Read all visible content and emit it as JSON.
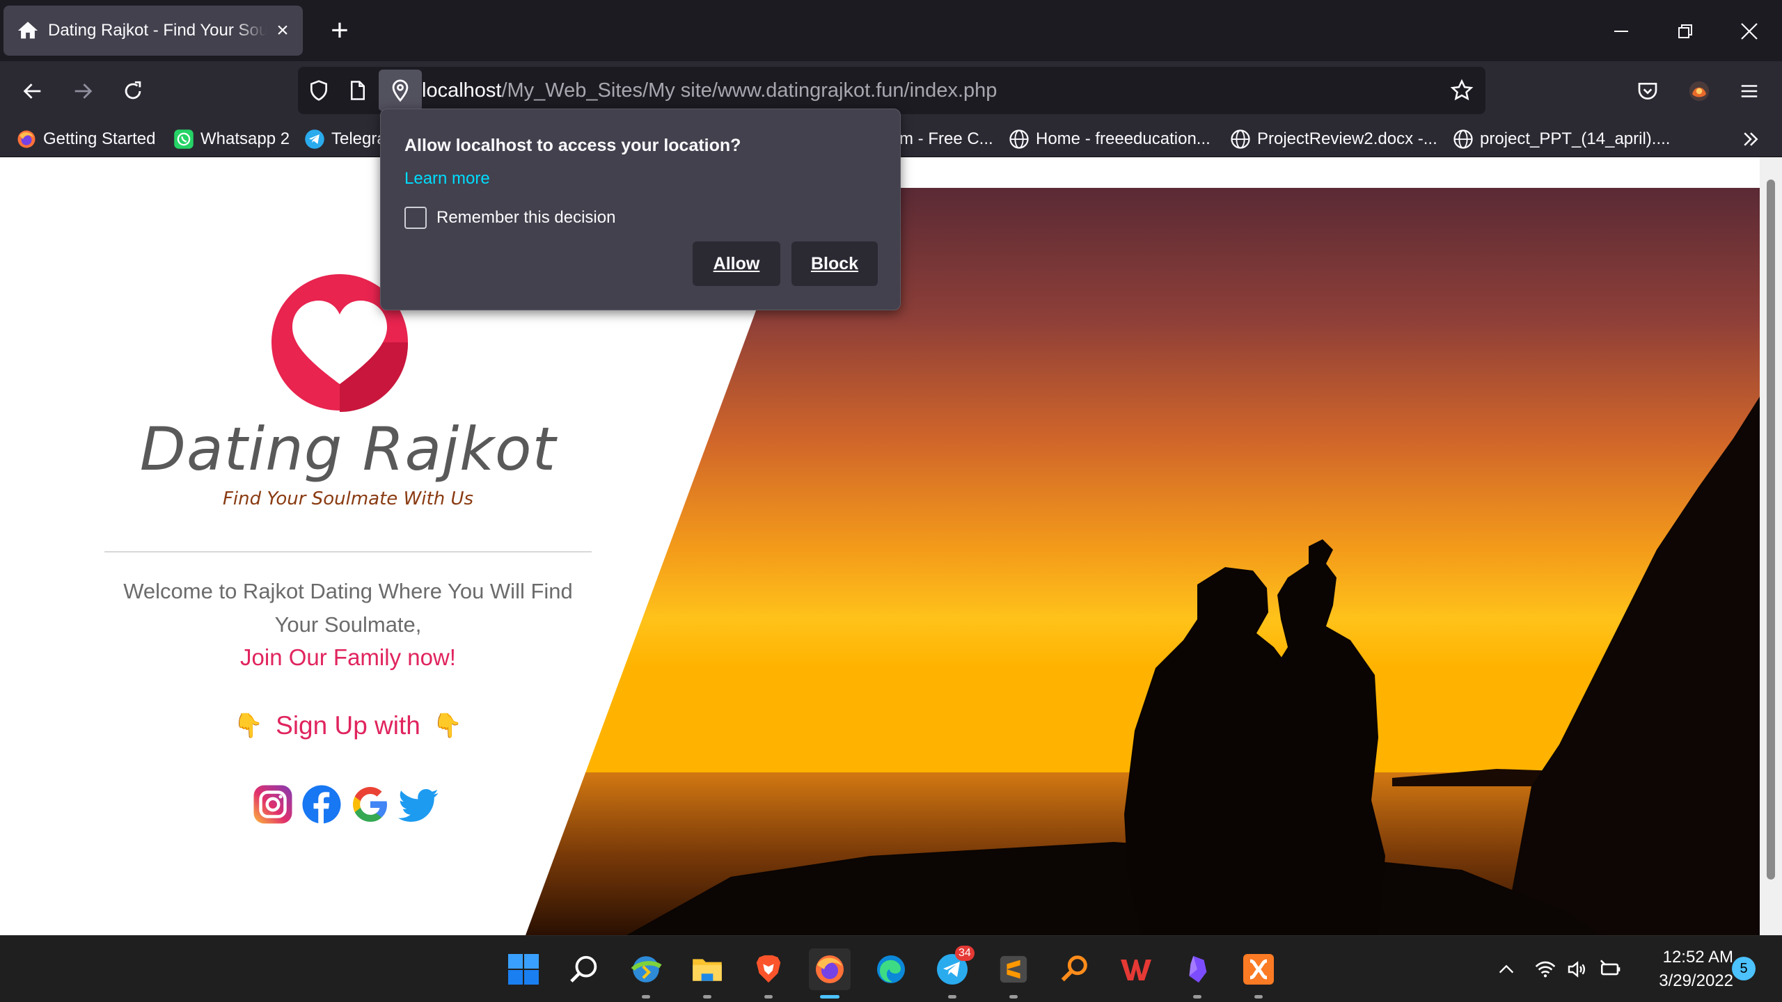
{
  "browser": {
    "tab_title": "Dating Rajkot - Find Your Soulmate With Us",
    "url_host": "localhost",
    "url_path": "/My_Web_Sites/My site/www.datingrajkot.fun/index.php",
    "bookmarks": [
      {
        "label": "Getting Started",
        "icon": "firefox-icon"
      },
      {
        "label": "Whatsapp 2",
        "icon": "whatsapp-icon"
      },
      {
        "label": "Telegra",
        "icon": "telegram-icon"
      },
      {
        "label": "m - Free C...",
        "icon": ""
      },
      {
        "label": "Home - freeeducation...",
        "icon": "globe-icon"
      },
      {
        "label": "ProjectReview2.docx -...",
        "icon": "globe-icon"
      },
      {
        "label": "project_PPT_(14_april)....",
        "icon": "globe-icon"
      }
    ]
  },
  "permission_popup": {
    "question": "Allow localhost to access your location?",
    "learn_more": "Learn more",
    "remember": "Remember this decision",
    "allow": "Allow",
    "block": "Block"
  },
  "site": {
    "brand": "Dating Rajkot",
    "tagline": "Find Your Soulmate With Us",
    "welcome": "Welcome to Rajkot Dating Where You Will Find Your Soulmate,",
    "join": "Join Our Family now!",
    "signup": "Sign Up with",
    "hand_glyph": "👇",
    "socials": [
      "instagram",
      "facebook",
      "google",
      "twitter"
    ]
  },
  "taskbar": {
    "time": "12:52 AM",
    "date": "3/29/2022",
    "notification_count": "5",
    "telegram_badge": "34"
  },
  "colors": {
    "accent_pink": "#e0245e",
    "tagline_brown": "#8a3b12",
    "firefox_link": "#00ddff"
  }
}
